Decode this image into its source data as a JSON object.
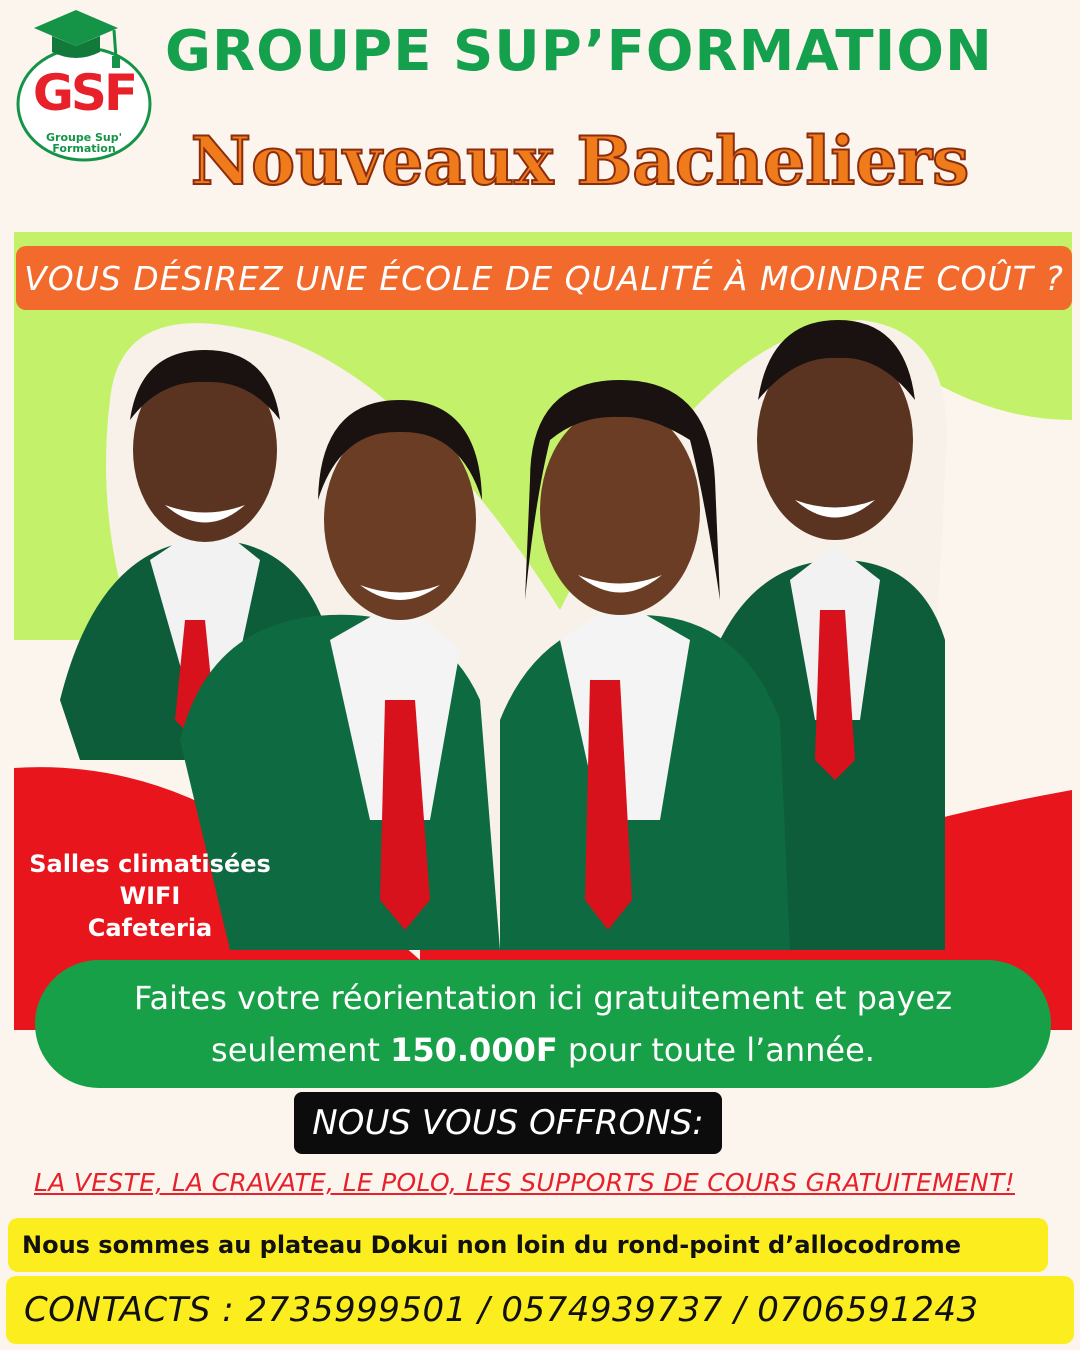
{
  "logo": {
    "abbr": "GSF",
    "line1": "Groupe Sup'",
    "line2": "Formation"
  },
  "brand_title": "GROUPE SUP’FORMATION",
  "main_title": "Nouveaux Bacheliers",
  "question": "VOUS DÉSIREZ UNE ÉCOLE DE QUALITÉ À MOINDRE COÛT ?",
  "features": [
    "Salles climatisées",
    "WIFI",
    "Cafeteria"
  ],
  "offer": {
    "line1": "Faites votre réorientation ici gratuitement et payez",
    "line2_before": "seulement ",
    "price": "150.000F",
    "line2_after": " pour  toute l’année."
  },
  "offrons": "NOUS VOUS OFFRONS:",
  "gifts": "LA VESTE, LA CRAVATE, LE POLO, LES SUPPORTS DE COURS GRATUITEMENT!",
  "address": "Nous sommes au plateau Dokui non loin du rond-point d’allocodrome",
  "contacts": "CONTACTS : 2735999501 / 0574939737 / 0706591243",
  "colors": {
    "background": "#fbf5ee",
    "green": "#14a04d",
    "orange": "#f26a2c",
    "red": "#e8151c",
    "lime": "#c3f26a",
    "yellow": "#fcee1e"
  },
  "icons": [
    "graduation-cap-icon"
  ]
}
